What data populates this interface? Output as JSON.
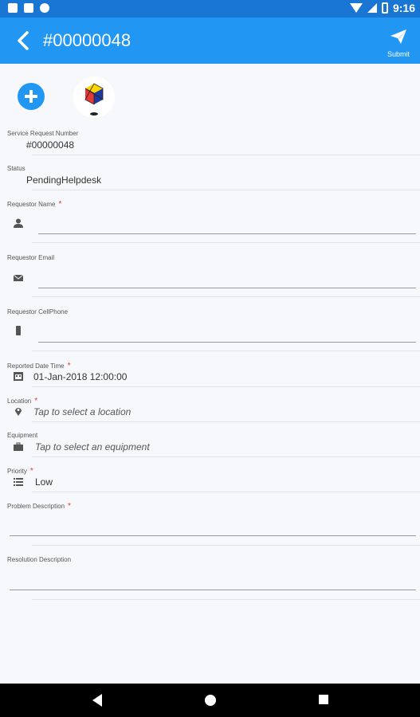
{
  "status_bar": {
    "time": "9:16"
  },
  "app_bar": {
    "title": "#00000048",
    "submit_label": "Submit"
  },
  "fields": {
    "service_request_number": {
      "label": "Service Request Number",
      "value": "#00000048"
    },
    "status": {
      "label": "Status",
      "value": "PendingHelpdesk"
    },
    "requestor_name": {
      "label": "Requestor Name",
      "required": "*",
      "value": ""
    },
    "requestor_email": {
      "label": "Requestor Email",
      "value": ""
    },
    "requestor_cellphone": {
      "label": "Requestor CellPhone",
      "value": ""
    },
    "reported_date_time": {
      "label": "Reported Date Time",
      "required": "*",
      "value": "01-Jan-2018 12:00:00"
    },
    "location": {
      "label": "Location",
      "required": "*",
      "value": "Tap to select a location"
    },
    "equipment": {
      "label": "Equipment",
      "value": "Tap to select an equipment"
    },
    "priority": {
      "label": "Priority",
      "required": "*",
      "value": "Low"
    },
    "problem_description": {
      "label": "Problem Description",
      "required": "*",
      "value": ""
    },
    "resolution_description": {
      "label": "Resolution Description",
      "value": ""
    }
  },
  "icons": {
    "back": "arrow-left-icon",
    "submit": "send-icon",
    "add": "plus-circle-icon",
    "avatar": "cube-icon",
    "person": "person-icon",
    "email": "envelope-icon",
    "phone": "phone-icon",
    "calendar": "calendar-icon",
    "location": "map-pin-icon",
    "equipment": "briefcase-icon",
    "priority": "list-icon"
  },
  "colors": {
    "primary": "#2196f3",
    "status_bar": "#1976d2",
    "required": "#e53935",
    "background": "#f6f8fb"
  }
}
